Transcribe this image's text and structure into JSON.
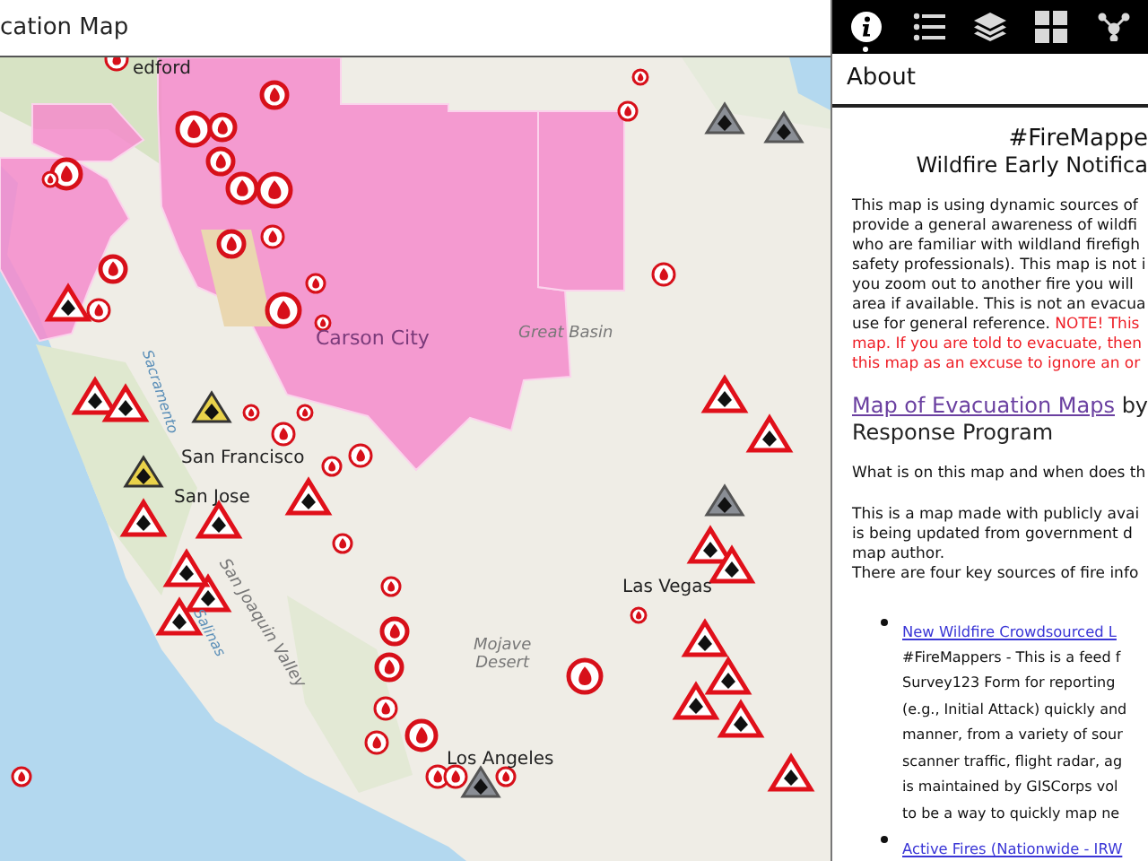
{
  "window": {
    "title": "cation Map"
  },
  "map": {
    "labels": [
      {
        "text": "edford",
        "kind": "city"
      },
      {
        "text": "Carson City",
        "kind": "city-purple"
      },
      {
        "text": "Great Basin",
        "kind": "region"
      },
      {
        "text": "Sacramento",
        "kind": "water"
      },
      {
        "text": "San Francisco",
        "kind": "city"
      },
      {
        "text": "San Jose",
        "kind": "city"
      },
      {
        "text": "San Joaquin Valley",
        "kind": "region"
      },
      {
        "text": "Salinas",
        "kind": "water"
      },
      {
        "text": "Mojave\nDesert",
        "kind": "region"
      },
      {
        "text": "Las Vegas",
        "kind": "city"
      },
      {
        "text": "Los Angeles",
        "kind": "city"
      }
    ]
  },
  "toolbar": {
    "tabs": [
      {
        "selected": true
      },
      {
        "selected": false
      },
      {
        "selected": false
      },
      {
        "selected": false
      },
      {
        "selected": false
      }
    ]
  },
  "panel": {
    "title": "About",
    "heading": "#FireMappe",
    "subheading": "Wildfire Early Notifica",
    "intro": [
      {
        "text": "This map is using dynamic sources of\nprovide a general awareness of wildfi\nwho are familiar with wildland firefigh\nsafety professionals). This map is not i\nyou zoom out to another fire you will \narea if available. This is not an evacua\nuse for general reference. ",
        "kind": "normal"
      },
      {
        "text": "NOTE! This\nmap. If you are told to evacuate, then\nthis map as an excuse to ignore an or",
        "kind": "warning"
      }
    ],
    "link_heading": {
      "link": "Map of Evacuation Maps",
      "rest": " by",
      "line2": "Response Program"
    },
    "question": "What is on this map and when does th",
    "body": "This is a map made with publicly avai\nis being updated from government d\nmap author.\nThere are four key sources of fire info",
    "sources": [
      {
        "link": "New Wildfire Crowdsourced L",
        "text": "#FireMappers - This is a feed f\nSurvey123 Form for reporting\n(e.g., Initial Attack) quickly and\nmanner, from a variety of sour\nscanner traffic, flight radar, ag\nis maintained by GISCorps vol\nto be a way to quickly map ne"
      },
      {
        "link": "Active Fires (Nationwide - IRW"
      }
    ]
  }
}
